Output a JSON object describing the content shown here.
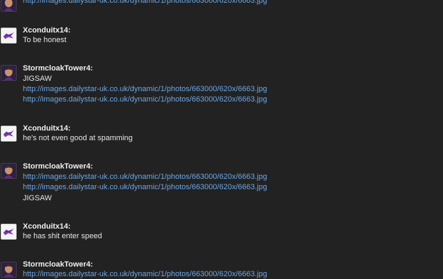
{
  "messages": [
    {
      "user": "",
      "lines": [
        {
          "type": "link",
          "text": "http://images.dailystar-uk.co.uk/dynamic/1/photos/663000/620x/6663.jpg"
        }
      ]
    },
    {
      "user": "Xconduitx14:",
      "lines": [
        {
          "type": "text",
          "text": "To be honest"
        }
      ]
    },
    {
      "user": "StormcloakTower4:",
      "lines": [
        {
          "type": "text",
          "text": "JIGSAW"
        },
        {
          "type": "link",
          "text": "http://images.dailystar-uk.co.uk/dynamic/1/photos/663000/620x/6663.jpg"
        },
        {
          "type": "link",
          "text": "http://images.dailystar-uk.co.uk/dynamic/1/photos/663000/620x/6663.jpg"
        }
      ]
    },
    {
      "user": "Xconduitx14:",
      "lines": [
        {
          "type": "text",
          "text": "he's not even good at spamming"
        }
      ]
    },
    {
      "user": "StormcloakTower4:",
      "lines": [
        {
          "type": "link",
          "text": "http://images.dailystar-uk.co.uk/dynamic/1/photos/663000/620x/6663.jpg"
        },
        {
          "type": "link",
          "text": "http://images.dailystar-uk.co.uk/dynamic/1/photos/663000/620x/6663.jpg"
        },
        {
          "type": "text",
          "text": "JIGSAW"
        }
      ]
    },
    {
      "user": "Xconduitx14:",
      "lines": [
        {
          "type": "text",
          "text": "he has shit enter speed"
        }
      ]
    },
    {
      "user": "StormcloakTower4:",
      "lines": [
        {
          "type": "link",
          "text": "http://images.dailystar-uk.co.uk/dynamic/1/photos/663000/620x/6663.jpg"
        }
      ]
    }
  ],
  "colors": {
    "background": "#222222",
    "link": "#6aa8e8",
    "text": "#e6e6e6",
    "username": "#f0f0f0"
  }
}
